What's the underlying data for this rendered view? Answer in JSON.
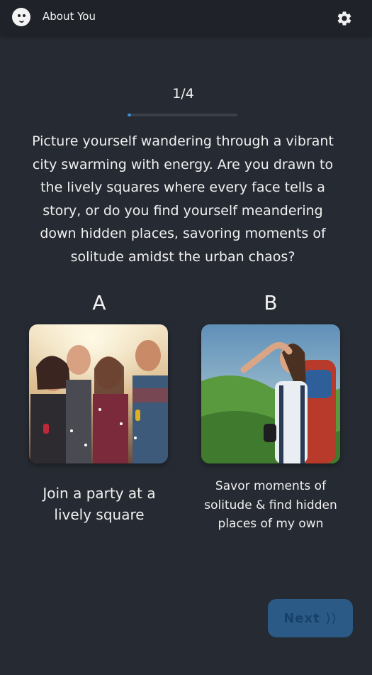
{
  "header": {
    "app_title": "About You",
    "logo_icon": "smiley-face-icon",
    "settings_icon": "gear-icon"
  },
  "progress": {
    "label": "1/4",
    "current": 1,
    "total": 4,
    "fill_fraction": 0.03,
    "accent_color": "#3a8ed8"
  },
  "question": {
    "text": "Picture yourself wandering through a vibrant city swarming with energy. Are you drawn to the lively squares where every face tells a story, or do you find yourself meandering down hidden places, savoring moments of solitude amidst the urban chaos?"
  },
  "options": [
    {
      "letter": "A",
      "text": "Join a party at a lively square"
    },
    {
      "letter": "B",
      "text": "Savor moments of solitude & find hidden places of my own"
    }
  ],
  "next_button": {
    "label": "Next",
    "chevron": "⟩⟩",
    "color": "#2a5a85"
  }
}
